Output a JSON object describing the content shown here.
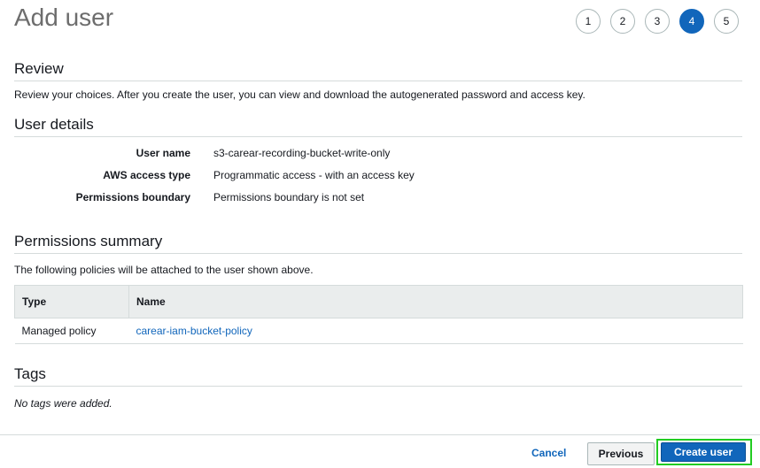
{
  "page_title": "Add user",
  "steps": [
    "1",
    "2",
    "3",
    "4",
    "5"
  ],
  "active_step": "4",
  "review": {
    "title": "Review",
    "description": "Review your choices. After you create the user, you can view and download the autogenerated password and access key."
  },
  "user_details": {
    "title": "User details",
    "rows": [
      {
        "label": "User name",
        "value": "s3-carear-recording-bucket-write-only"
      },
      {
        "label": "AWS access type",
        "value": "Programmatic access - with an access key"
      },
      {
        "label": "Permissions boundary",
        "value": "Permissions boundary is not set"
      }
    ]
  },
  "permissions_summary": {
    "title": "Permissions summary",
    "description": "The following policies will be attached to the user shown above.",
    "columns": [
      "Type",
      "Name"
    ],
    "rows": [
      {
        "type": "Managed policy",
        "name": "carear-iam-bucket-policy"
      }
    ]
  },
  "tags": {
    "title": "Tags",
    "empty_text": "No tags were added."
  },
  "footer": {
    "cancel_label": "Cancel",
    "previous_label": "Previous",
    "create_label": "Create user"
  },
  "colors": {
    "accent": "#1166bb",
    "highlight_outline": "#22cc22"
  }
}
